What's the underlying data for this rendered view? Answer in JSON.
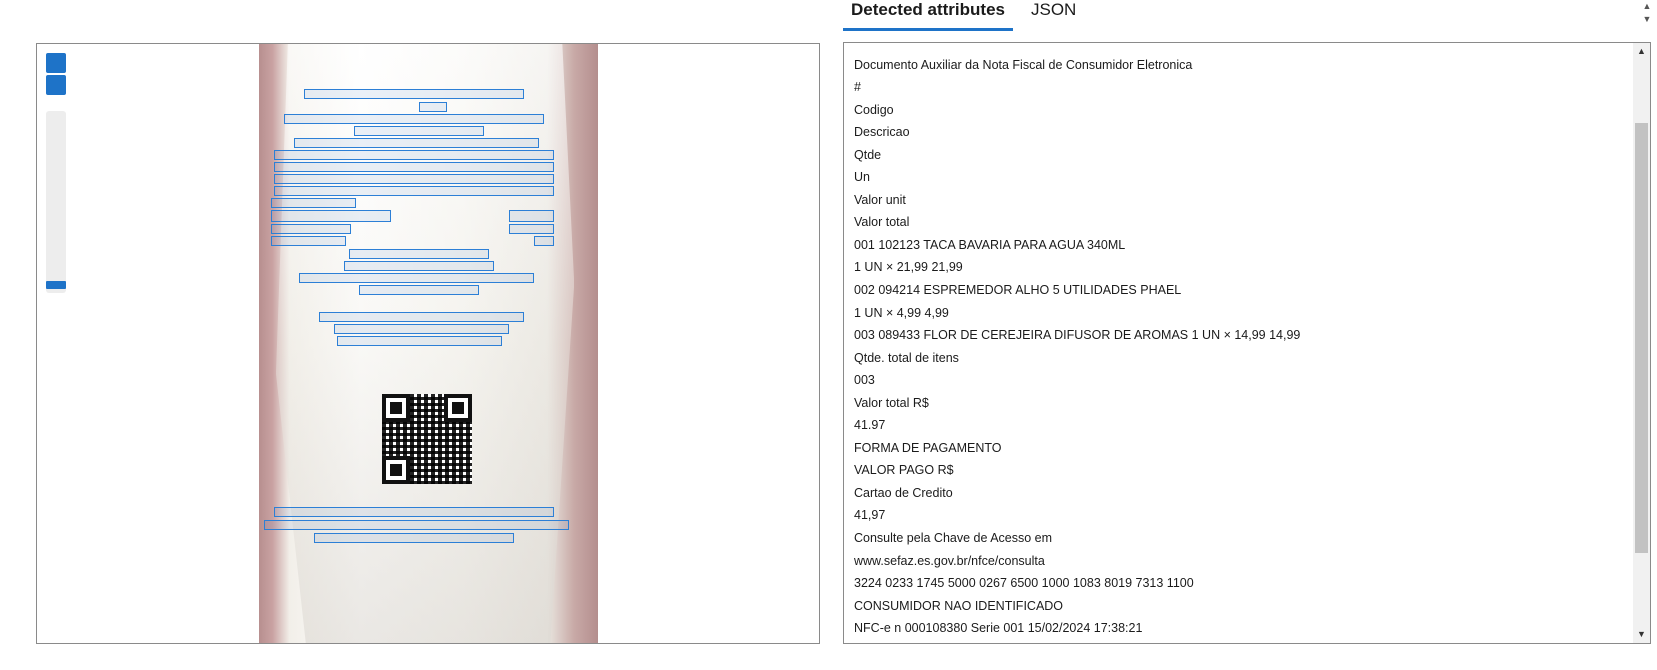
{
  "tabs": {
    "detected": "Detected attributes",
    "json": "JSON"
  },
  "viewer": {
    "zoom_in_icon": "plus-icon",
    "zoom_out_icon": "minus-icon"
  },
  "attributes": [
    "Documento Auxiliar da Nota Fiscal de Consumidor Eletronica",
    "#",
    "Codigo",
    "Descricao",
    "Qtde",
    "Un",
    "Valor unit",
    "Valor total",
    "001 102123 TACA BAVARIA PARA AGUA 340ML",
    "1 UN × 21,99 21,99",
    "002 094214 ESPREMEDOR ALHO 5 UTILIDADES PHAEL",
    "1 UN × 4,99 4,99",
    "003 089433 FLOR DE CEREJEIRA DIFUSOR DE AROMAS 1 UN × 14,99 14,99",
    "Qtde. total de itens",
    "003",
    "Valor total R$",
    "41.97",
    "FORMA DE PAGAMENTO",
    "VALOR PAGO R$",
    "Cartao de Credito",
    "41,97",
    "Consulte pela Chave de Acesso em",
    "www.sefaz.es.gov.br/nfce/consulta",
    "3224 0233 1745 5000 0267 6500 1000 1083 8019 7313 1100",
    "CONSUMIDOR NAO IDENTIFICADO",
    "NFC-e n 000108380 Serie 001 15/02/2024 17:38:21"
  ],
  "colors": {
    "accent": "#1e73c8",
    "box": "#2c7fd6"
  }
}
